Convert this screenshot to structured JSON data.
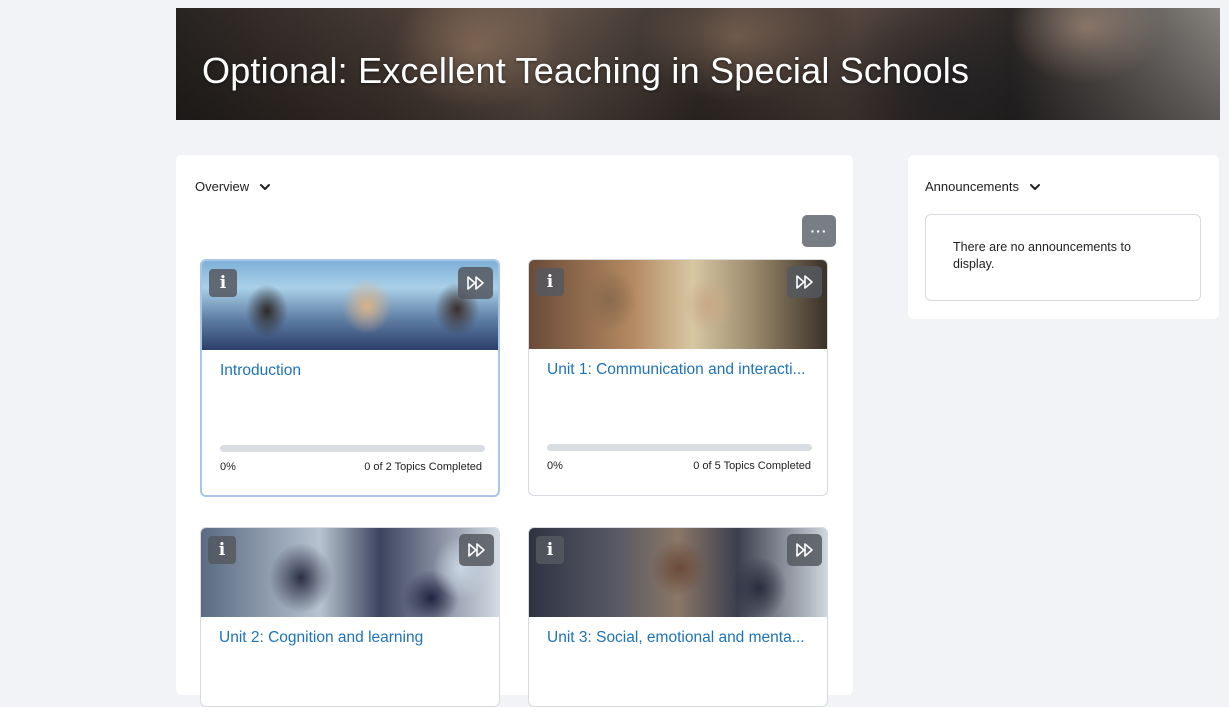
{
  "course": {
    "title": "Optional: Excellent Teaching in Special Schools"
  },
  "overview": {
    "header_label": "Overview",
    "more_label": "···",
    "cards": [
      {
        "title": "Introduction",
        "progress_percent": "0%",
        "progress_value": 0,
        "completed_text": "0 of 2 Topics Completed"
      },
      {
        "title": "Unit 1: Communication and interacti...",
        "progress_percent": "0%",
        "progress_value": 0,
        "completed_text": "0 of 5 Topics Completed"
      },
      {
        "title": "Unit 2: Cognition and learning"
      },
      {
        "title": "Unit 3: Social, emotional and menta..."
      }
    ],
    "info_icon_glyph": "i"
  },
  "announcements": {
    "header_label": "Announcements",
    "empty_text": "There are no announcements to display."
  },
  "colors": {
    "link": "#1e73b8",
    "page_bg": "#f1f3f6",
    "progress_track": "#d8dde4"
  },
  "icons": {
    "info": "info-icon",
    "fast_forward": "fast-forward-icon",
    "chevron": "chevron-down-icon",
    "more": "more-options-icon"
  }
}
